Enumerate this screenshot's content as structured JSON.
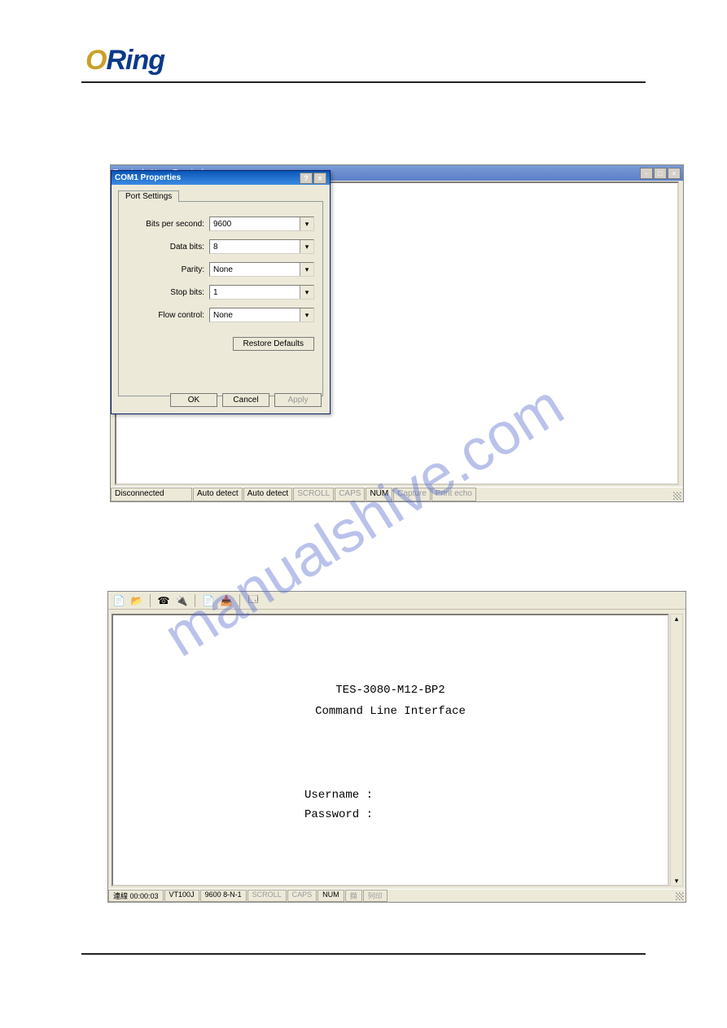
{
  "watermark": "manualshive.com",
  "logo": {
    "o": "O",
    "ring": "Ring"
  },
  "shot1": {
    "app_title": "Terminal - HyperTerminal",
    "dialog": {
      "title": "COM1 Properties",
      "tab": "Port Settings",
      "fields": {
        "bps_label": "Bits per second:",
        "bps_value": "9600",
        "databits_label": "Data bits:",
        "databits_value": "8",
        "parity_label": "Parity:",
        "parity_value": "None",
        "stopbits_label": "Stop bits:",
        "stopbits_value": "1",
        "flow_label": "Flow control:",
        "flow_value": "None"
      },
      "restore_btn": "Restore Defaults",
      "ok": "OK",
      "cancel": "Cancel",
      "apply": "Apply"
    },
    "status": {
      "conn": "Disconnected",
      "ad1": "Auto detect",
      "ad2": "Auto detect",
      "scroll": "SCROLL",
      "caps": "CAPS",
      "num": "NUM",
      "capture": "Capture",
      "echo": "Print echo"
    }
  },
  "shot2": {
    "terminal": {
      "line1": "TES-3080-M12-BP2",
      "line2": "Command Line Interface",
      "user": "Username :",
      "pass": "Password :"
    },
    "status": {
      "conn": "連線 00:00:03",
      "emu": "VT100J",
      "cfg": "9600 8-N-1",
      "scroll": "SCROLL",
      "caps": "CAPS",
      "num": "NUM",
      "cap": "擷",
      "echo": "列印"
    }
  }
}
